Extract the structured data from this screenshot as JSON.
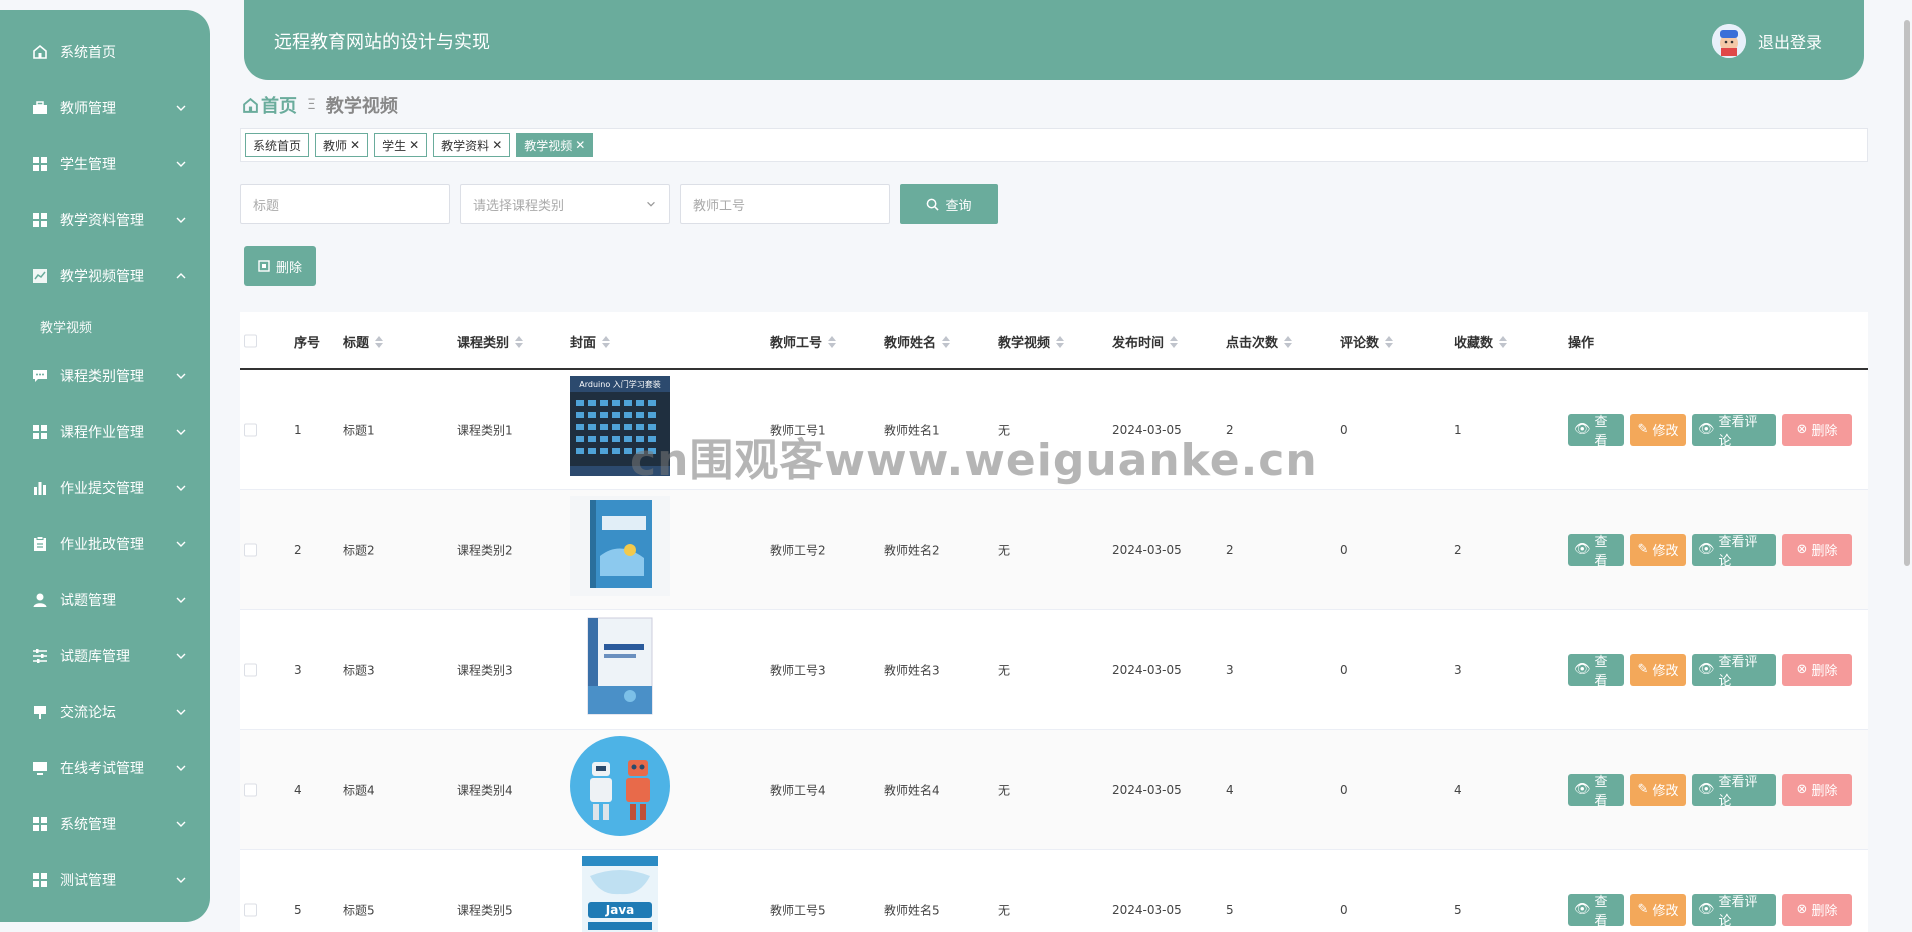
{
  "sidebar": {
    "items": [
      {
        "label": "系统首页",
        "icon": "home-icon"
      },
      {
        "label": "教师管理",
        "icon": "briefcase-icon"
      },
      {
        "label": "学生管理",
        "icon": "grid-icon"
      },
      {
        "label": "教学资料管理",
        "icon": "grid-icon"
      },
      {
        "label": "教学视频管理",
        "icon": "chart-icon"
      },
      {
        "label": "课程类别管理",
        "icon": "chat-icon"
      },
      {
        "label": "课程作业管理",
        "icon": "grid-icon"
      },
      {
        "label": "作业提交管理",
        "icon": "bar-chart-icon"
      },
      {
        "label": "作业批改管理",
        "icon": "clipboard-icon"
      },
      {
        "label": "试题管理",
        "icon": "user-icon"
      },
      {
        "label": "试题库管理",
        "icon": "sliders-icon"
      },
      {
        "label": "交流论坛",
        "icon": "sign-icon"
      },
      {
        "label": "在线考试管理",
        "icon": "monitor-icon"
      },
      {
        "label": "系统管理",
        "icon": "grid-icon"
      },
      {
        "label": "测试管理",
        "icon": "grid-icon"
      }
    ],
    "submenu": {
      "label": "教学视频"
    }
  },
  "header": {
    "title": "远程教育网站的设计与实现",
    "logout": "退出登录"
  },
  "breadcrumb": {
    "home": "首页",
    "separator": "Ξ",
    "current": "教学视频"
  },
  "tags": [
    {
      "label": "系统首页",
      "closable": false
    },
    {
      "label": "教师",
      "closable": true
    },
    {
      "label": "学生",
      "closable": true
    },
    {
      "label": "教学资料",
      "closable": true
    },
    {
      "label": "教学视频",
      "closable": true,
      "active": true
    }
  ],
  "search": {
    "title_placeholder": "标题",
    "category_placeholder": "请选择课程类别",
    "teacher_placeholder": "教师工号",
    "query_label": "查询"
  },
  "toolbar": {
    "delete_label": "删除"
  },
  "table": {
    "columns": [
      "序号",
      "标题",
      "课程类别",
      "封面",
      "教师工号",
      "教师姓名",
      "教学视频",
      "发布时间",
      "点击次数",
      "评论数",
      "收藏数",
      "操作"
    ],
    "rows": [
      {
        "index": "1",
        "title": "标题1",
        "category": "课程类别1",
        "teacher_no": "教师工号1",
        "teacher_name": "教师姓名1",
        "video": "无",
        "date": "2024-03-05",
        "clicks": "2",
        "comments": "0",
        "favorites": "1"
      },
      {
        "index": "2",
        "title": "标题2",
        "category": "课程类别2",
        "teacher_no": "教师工号2",
        "teacher_name": "教师姓名2",
        "video": "无",
        "date": "2024-03-05",
        "clicks": "2",
        "comments": "0",
        "favorites": "2"
      },
      {
        "index": "3",
        "title": "标题3",
        "category": "课程类别3",
        "teacher_no": "教师工号3",
        "teacher_name": "教师姓名3",
        "video": "无",
        "date": "2024-03-05",
        "clicks": "3",
        "comments": "0",
        "favorites": "3"
      },
      {
        "index": "4",
        "title": "标题4",
        "category": "课程类别4",
        "teacher_no": "教师工号4",
        "teacher_name": "教师姓名4",
        "video": "无",
        "date": "2024-03-05",
        "clicks": "4",
        "comments": "0",
        "favorites": "4"
      },
      {
        "index": "5",
        "title": "标题5",
        "category": "课程类别5",
        "teacher_no": "教师工号5",
        "teacher_name": "教师姓名5",
        "video": "无",
        "date": "2024-03-05",
        "clicks": "5",
        "comments": "0",
        "favorites": "5"
      }
    ],
    "actions": {
      "view": "查看",
      "edit": "修改",
      "comments": "查看评论",
      "delete": "删除"
    },
    "cover_texts": {
      "arduino": "Arduino 入门学习套装",
      "java": "Java"
    }
  },
  "watermark": "cn围观客www.weiguanke.cn",
  "colors": {
    "primary": "#6aac9c",
    "warning": "#f3a85a",
    "danger": "#f59a9a"
  }
}
